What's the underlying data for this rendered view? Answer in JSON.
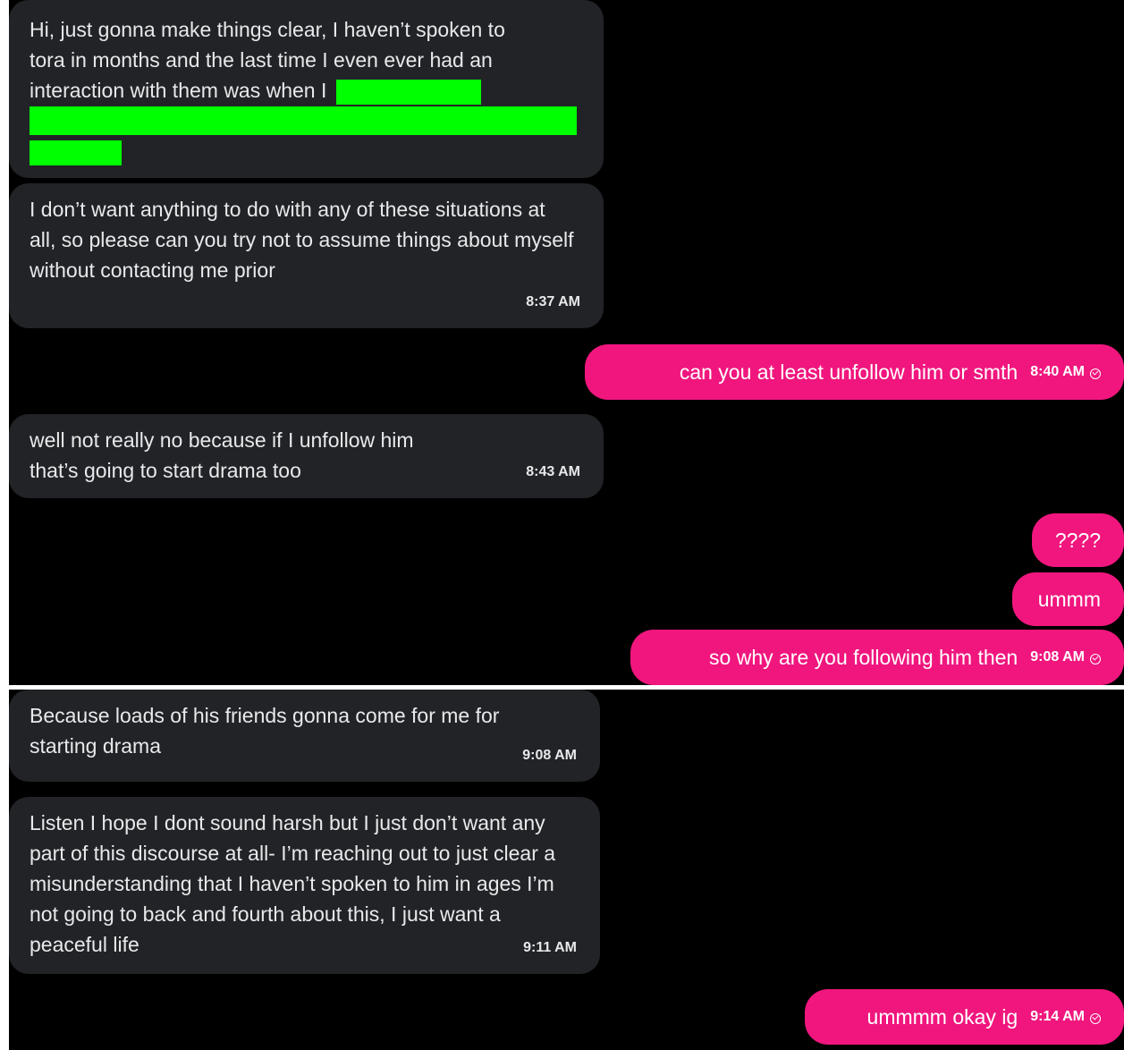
{
  "top_panel": {
    "m1": {
      "line1": "Hi, just gonna make things clear, I haven’t spoken to",
      "line2": "tora in months and the last time I even ever had an",
      "line3": "interaction with them was when I",
      "redaction_color": "#00ff00"
    },
    "m2": {
      "text": "I don’t want anything to do with any of these situations at all, so please can you try not to assume things about myself without contacting me prior",
      "time": "8:37 AM"
    },
    "m3": {
      "text": "can you at least unfollow him or smth",
      "time": "8:40 AM"
    },
    "m4": {
      "text": "well not really no because if I unfollow him that’s going to start drama too",
      "time": "8:43 AM"
    },
    "m5": {
      "text": "????"
    },
    "m6": {
      "text": "ummm"
    },
    "m7": {
      "text": "so why are you following him then",
      "time": "9:08 AM"
    }
  },
  "bottom_panel": {
    "m8": {
      "text": "Because loads of his friends gonna come for me for starting drama",
      "time": "9:08 AM"
    },
    "m9": {
      "text": "Listen I hope I dont sound harsh but I just don’t want any part of this discourse at all- I’m reaching out to just clear a misunderstanding that I haven’t spoken to him in ages I’m not going to back and fourth about this, I just want a peaceful life",
      "time": "9:11 AM"
    },
    "m10": {
      "text": "ummmm okay ig",
      "time": "9:14 AM"
    }
  },
  "colors": {
    "background": "#000000",
    "incoming_bubble": "#212327",
    "outgoing_bubble": "#f0167e",
    "text": "#e7e9ea"
  },
  "icons": {
    "sent_status": "check-circle-icon"
  }
}
